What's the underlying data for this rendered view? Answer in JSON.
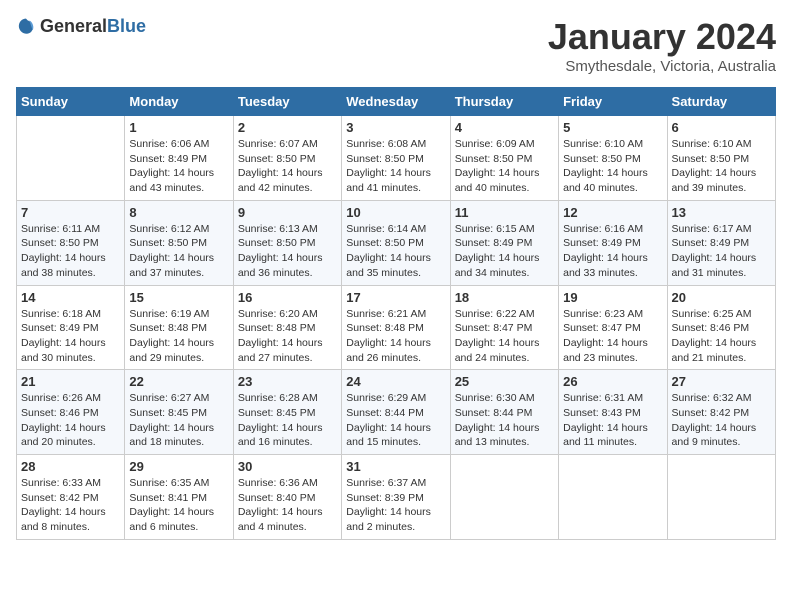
{
  "header": {
    "logo_general": "General",
    "logo_blue": "Blue",
    "title": "January 2024",
    "subtitle": "Smythesdale, Victoria, Australia"
  },
  "weekdays": [
    "Sunday",
    "Monday",
    "Tuesday",
    "Wednesday",
    "Thursday",
    "Friday",
    "Saturday"
  ],
  "weeks": [
    [
      {
        "day": "",
        "sunrise": "",
        "sunset": "",
        "daylight": ""
      },
      {
        "day": "1",
        "sunrise": "Sunrise: 6:06 AM",
        "sunset": "Sunset: 8:49 PM",
        "daylight": "Daylight: 14 hours and 43 minutes."
      },
      {
        "day": "2",
        "sunrise": "Sunrise: 6:07 AM",
        "sunset": "Sunset: 8:50 PM",
        "daylight": "Daylight: 14 hours and 42 minutes."
      },
      {
        "day": "3",
        "sunrise": "Sunrise: 6:08 AM",
        "sunset": "Sunset: 8:50 PM",
        "daylight": "Daylight: 14 hours and 41 minutes."
      },
      {
        "day": "4",
        "sunrise": "Sunrise: 6:09 AM",
        "sunset": "Sunset: 8:50 PM",
        "daylight": "Daylight: 14 hours and 40 minutes."
      },
      {
        "day": "5",
        "sunrise": "Sunrise: 6:10 AM",
        "sunset": "Sunset: 8:50 PM",
        "daylight": "Daylight: 14 hours and 40 minutes."
      },
      {
        "day": "6",
        "sunrise": "Sunrise: 6:10 AM",
        "sunset": "Sunset: 8:50 PM",
        "daylight": "Daylight: 14 hours and 39 minutes."
      }
    ],
    [
      {
        "day": "7",
        "sunrise": "Sunrise: 6:11 AM",
        "sunset": "Sunset: 8:50 PM",
        "daylight": "Daylight: 14 hours and 38 minutes."
      },
      {
        "day": "8",
        "sunrise": "Sunrise: 6:12 AM",
        "sunset": "Sunset: 8:50 PM",
        "daylight": "Daylight: 14 hours and 37 minutes."
      },
      {
        "day": "9",
        "sunrise": "Sunrise: 6:13 AM",
        "sunset": "Sunset: 8:50 PM",
        "daylight": "Daylight: 14 hours and 36 minutes."
      },
      {
        "day": "10",
        "sunrise": "Sunrise: 6:14 AM",
        "sunset": "Sunset: 8:50 PM",
        "daylight": "Daylight: 14 hours and 35 minutes."
      },
      {
        "day": "11",
        "sunrise": "Sunrise: 6:15 AM",
        "sunset": "Sunset: 8:49 PM",
        "daylight": "Daylight: 14 hours and 34 minutes."
      },
      {
        "day": "12",
        "sunrise": "Sunrise: 6:16 AM",
        "sunset": "Sunset: 8:49 PM",
        "daylight": "Daylight: 14 hours and 33 minutes."
      },
      {
        "day": "13",
        "sunrise": "Sunrise: 6:17 AM",
        "sunset": "Sunset: 8:49 PM",
        "daylight": "Daylight: 14 hours and 31 minutes."
      }
    ],
    [
      {
        "day": "14",
        "sunrise": "Sunrise: 6:18 AM",
        "sunset": "Sunset: 8:49 PM",
        "daylight": "Daylight: 14 hours and 30 minutes."
      },
      {
        "day": "15",
        "sunrise": "Sunrise: 6:19 AM",
        "sunset": "Sunset: 8:48 PM",
        "daylight": "Daylight: 14 hours and 29 minutes."
      },
      {
        "day": "16",
        "sunrise": "Sunrise: 6:20 AM",
        "sunset": "Sunset: 8:48 PM",
        "daylight": "Daylight: 14 hours and 27 minutes."
      },
      {
        "day": "17",
        "sunrise": "Sunrise: 6:21 AM",
        "sunset": "Sunset: 8:48 PM",
        "daylight": "Daylight: 14 hours and 26 minutes."
      },
      {
        "day": "18",
        "sunrise": "Sunrise: 6:22 AM",
        "sunset": "Sunset: 8:47 PM",
        "daylight": "Daylight: 14 hours and 24 minutes."
      },
      {
        "day": "19",
        "sunrise": "Sunrise: 6:23 AM",
        "sunset": "Sunset: 8:47 PM",
        "daylight": "Daylight: 14 hours and 23 minutes."
      },
      {
        "day": "20",
        "sunrise": "Sunrise: 6:25 AM",
        "sunset": "Sunset: 8:46 PM",
        "daylight": "Daylight: 14 hours and 21 minutes."
      }
    ],
    [
      {
        "day": "21",
        "sunrise": "Sunrise: 6:26 AM",
        "sunset": "Sunset: 8:46 PM",
        "daylight": "Daylight: 14 hours and 20 minutes."
      },
      {
        "day": "22",
        "sunrise": "Sunrise: 6:27 AM",
        "sunset": "Sunset: 8:45 PM",
        "daylight": "Daylight: 14 hours and 18 minutes."
      },
      {
        "day": "23",
        "sunrise": "Sunrise: 6:28 AM",
        "sunset": "Sunset: 8:45 PM",
        "daylight": "Daylight: 14 hours and 16 minutes."
      },
      {
        "day": "24",
        "sunrise": "Sunrise: 6:29 AM",
        "sunset": "Sunset: 8:44 PM",
        "daylight": "Daylight: 14 hours and 15 minutes."
      },
      {
        "day": "25",
        "sunrise": "Sunrise: 6:30 AM",
        "sunset": "Sunset: 8:44 PM",
        "daylight": "Daylight: 14 hours and 13 minutes."
      },
      {
        "day": "26",
        "sunrise": "Sunrise: 6:31 AM",
        "sunset": "Sunset: 8:43 PM",
        "daylight": "Daylight: 14 hours and 11 minutes."
      },
      {
        "day": "27",
        "sunrise": "Sunrise: 6:32 AM",
        "sunset": "Sunset: 8:42 PM",
        "daylight": "Daylight: 14 hours and 9 minutes."
      }
    ],
    [
      {
        "day": "28",
        "sunrise": "Sunrise: 6:33 AM",
        "sunset": "Sunset: 8:42 PM",
        "daylight": "Daylight: 14 hours and 8 minutes."
      },
      {
        "day": "29",
        "sunrise": "Sunrise: 6:35 AM",
        "sunset": "Sunset: 8:41 PM",
        "daylight": "Daylight: 14 hours and 6 minutes."
      },
      {
        "day": "30",
        "sunrise": "Sunrise: 6:36 AM",
        "sunset": "Sunset: 8:40 PM",
        "daylight": "Daylight: 14 hours and 4 minutes."
      },
      {
        "day": "31",
        "sunrise": "Sunrise: 6:37 AM",
        "sunset": "Sunset: 8:39 PM",
        "daylight": "Daylight: 14 hours and 2 minutes."
      },
      {
        "day": "",
        "sunrise": "",
        "sunset": "",
        "daylight": ""
      },
      {
        "day": "",
        "sunrise": "",
        "sunset": "",
        "daylight": ""
      },
      {
        "day": "",
        "sunrise": "",
        "sunset": "",
        "daylight": ""
      }
    ]
  ]
}
